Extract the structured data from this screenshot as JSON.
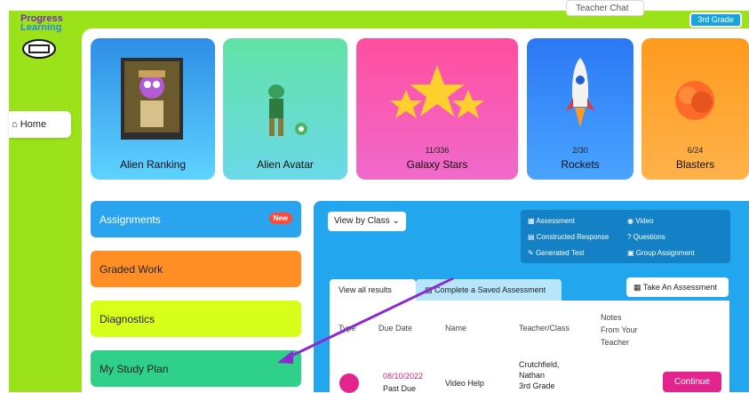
{
  "app": {
    "logo_line1": "Progress",
    "logo_line2": "Learning"
  },
  "topbar": {
    "teacher_chat": "Teacher Chat",
    "grade": "3rd Grade"
  },
  "sidebar": {
    "home": "Home"
  },
  "cards": [
    {
      "label": "Alien Ranking",
      "count": ""
    },
    {
      "label": "Alien Avatar",
      "count": ""
    },
    {
      "label": "Galaxy Stars",
      "count": "11/336"
    },
    {
      "label": "Rockets",
      "count": "2/30"
    },
    {
      "label": "Blasters",
      "count": "6/24"
    }
  ],
  "nav": {
    "assignments": "Assignments",
    "new_badge": "New",
    "graded_work": "Graded Work",
    "diagnostics": "Diagnostics",
    "study_plan": "My Study Plan"
  },
  "results": {
    "view_by": "View by Class",
    "legend": {
      "assessment": "Assessment",
      "constructed": "Constructed Response",
      "generated": "Generated Test",
      "video": "Video",
      "questions": "Questions",
      "group": "Group Assignment"
    },
    "tab_all": "View all results",
    "tab_saved": "Complete a Saved Assessment",
    "take_assessment": "Take An Assessment",
    "columns": {
      "type": "Type",
      "due_date": "Due Date",
      "name": "Name",
      "teacher": "Teacher/Class",
      "notes_l1": "Notes",
      "notes_l2": "From Your",
      "notes_l3": "Teacher"
    },
    "row": {
      "date": "08/10/2022",
      "status": "Past Due",
      "name": "Video Help",
      "teacher_l1": "Crutchfield,",
      "teacher_l2": "Nathan",
      "teacher_l3": "3rd Grade",
      "action": "Continue"
    }
  },
  "colors": {
    "sidebar_green": "#9be21a",
    "accent_blue": "#22a6ee",
    "accent_pink": "#e3248d",
    "arrow": "#8a2bd0"
  }
}
